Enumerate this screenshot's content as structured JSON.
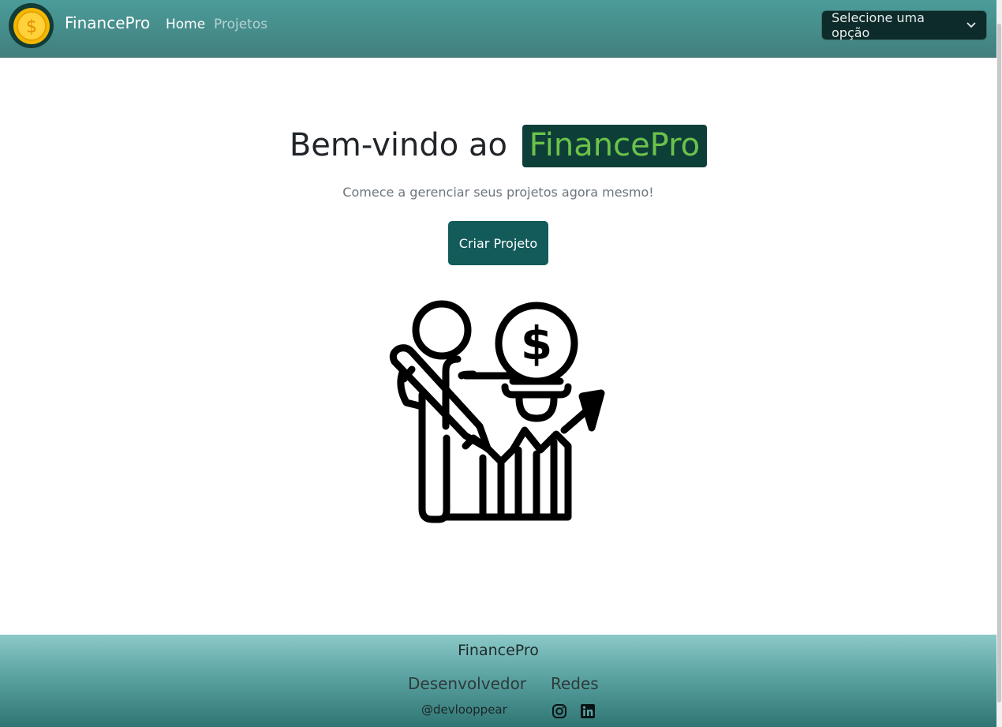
{
  "navbar": {
    "brand": "FinancePro",
    "links": [
      {
        "label": "Home",
        "active": true
      },
      {
        "label": "Projetos",
        "active": false
      }
    ],
    "select": {
      "selected": "Selecione uma opção"
    }
  },
  "hero": {
    "title_prefix": "Bem-vindo ao",
    "title_highlight": "FinancePro",
    "subtitle": "Comece a gerenciar seus projetos agora mesmo!",
    "cta_label": "Criar Projeto",
    "illustration_icon": "finance-idea-person-icon"
  },
  "footer": {
    "brand": "FinancePro",
    "developer_title": "Desenvolvedor",
    "developer_handle": "@devlooppear",
    "social_title": "Redes",
    "social_icons": [
      "instagram-icon",
      "linkedin-icon"
    ]
  },
  "colors": {
    "navbar": "#4a9c9a",
    "highlight_bg": "#0d3f38",
    "highlight_text": "#6cc24a",
    "button": "#135b5a",
    "footer": "#5ba3a2"
  }
}
